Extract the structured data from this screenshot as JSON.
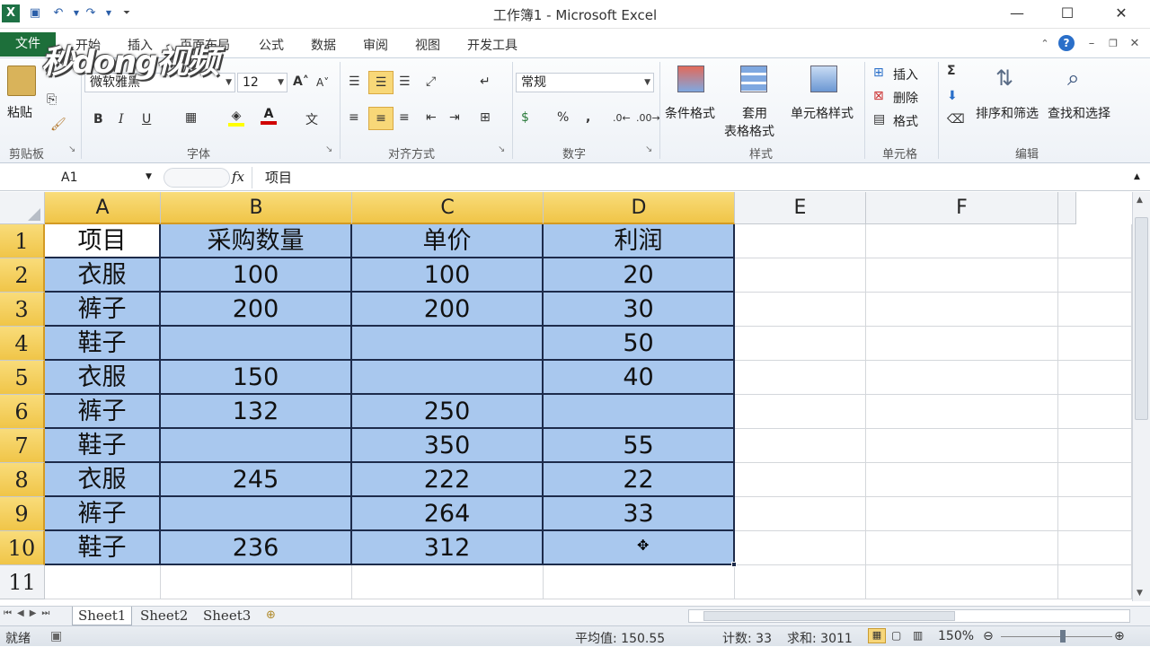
{
  "window": {
    "title": "工作簿1 - Microsoft Excel",
    "minimize": "—",
    "maximize": "☐",
    "close": "✕"
  },
  "tabs": {
    "file": "文件",
    "items": [
      "开始",
      "插入",
      "页面布局",
      "公式",
      "数据",
      "审阅",
      "视图",
      "开发工具"
    ]
  },
  "watermark": "秒dong视频",
  "ribbon": {
    "clipboard": {
      "label": "剪贴板",
      "paste": "粘贴"
    },
    "font": {
      "label": "字体",
      "name": "微软雅黑",
      "size": "12",
      "bold": "B",
      "italic": "I",
      "underline": "U"
    },
    "alignment": {
      "label": "对齐方式"
    },
    "number": {
      "label": "数字",
      "format": "常规",
      "percent": "%",
      "comma": ","
    },
    "styles": {
      "label": "样式",
      "conditional": "条件格式",
      "table_line1": "套用",
      "table_line2": "表格格式",
      "cell_styles": "单元格样式"
    },
    "cells": {
      "label": "单元格",
      "insert": "插入",
      "delete": "删除",
      "format": "格式"
    },
    "editing": {
      "label": "编辑",
      "sum": "Σ",
      "sort_filter": "排序和筛选",
      "find_select": "查找和选择"
    }
  },
  "formula_bar": {
    "name_box": "A1",
    "fx": "fx",
    "content": "项目"
  },
  "columns": [
    "A",
    "B",
    "C",
    "D",
    "E",
    "F"
  ],
  "rows": [
    "1",
    "2",
    "3",
    "4",
    "5",
    "6",
    "7",
    "8",
    "9",
    "10",
    "11"
  ],
  "table": [
    [
      "项目",
      "采购数量",
      "单价",
      "利润"
    ],
    [
      "衣服",
      "100",
      "100",
      "20"
    ],
    [
      "裤子",
      "200",
      "200",
      "30"
    ],
    [
      "鞋子",
      "",
      "",
      "50"
    ],
    [
      "衣服",
      "150",
      "",
      "40"
    ],
    [
      "裤子",
      "132",
      "250",
      ""
    ],
    [
      "鞋子",
      "",
      "350",
      "55"
    ],
    [
      "衣服",
      "245",
      "222",
      "22"
    ],
    [
      "裤子",
      "",
      "264",
      "33"
    ],
    [
      "鞋子",
      "236",
      "312",
      ""
    ]
  ],
  "sheets": [
    "Sheet1",
    "Sheet2",
    "Sheet3"
  ],
  "status": {
    "ready": "就绪",
    "average": "平均值: 150.55",
    "count": "计数: 33",
    "sum": "求和: 3011",
    "zoom": "150%"
  },
  "colors": {
    "accent": "#1d6f3a",
    "selection": "#a9c8ee",
    "header_selected": "#f0c548"
  }
}
